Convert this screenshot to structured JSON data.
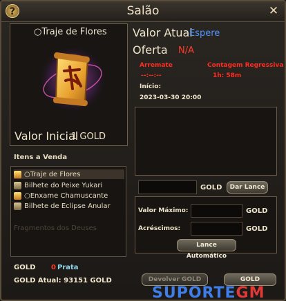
{
  "window": {
    "title": "Salão",
    "help": "?",
    "close": "✕"
  },
  "item": {
    "name": "○Traje de Flores",
    "valor_inicial_label": "Valor Inicial",
    "valor_inicial_value": "1 GOLD"
  },
  "items_for_sale": {
    "heading": "Itens a Venda",
    "rows": [
      {
        "label": "○Traje de Flores",
        "icon": "scroll-icon"
      },
      {
        "label": "Bilhete do Peixe Yukari",
        "icon": "ticket-icon"
      },
      {
        "label": "○Enxame Chamuscante",
        "icon": "scroll-icon"
      },
      {
        "label": "Bilhete de Eclipse Anular",
        "icon": "ticket-icon"
      }
    ],
    "faded_text": "Fragmentos dos Deuses"
  },
  "wallet": {
    "gold_label": "GOLD",
    "prata_value": "0",
    "prata_label": "Prata",
    "gold_atual": "GOLD Atual:  93151 GOLD"
  },
  "auction": {
    "valor_atual_label": "Valor Atual",
    "valor_atual_value": "Espere",
    "oferta_label": "Oferta",
    "oferta_value": "N/A",
    "arremate_label": "Arremate",
    "arremate_value": "--:--:--",
    "contagem_label": "Contagem Regressiva",
    "contagem_value": "1h: 58m",
    "inicio_label": "Início:",
    "inicio_value": "2023-03-30 20:00"
  },
  "bid": {
    "gold_unit": "GOLD",
    "dar_lance": "Dar Lance",
    "valor_maximo_label": "Valor Máximo:",
    "acrescimos_label": "Acréscimos:",
    "lance_automatico": "Lance Automático"
  },
  "footer": {
    "devolver_gold": "Devolver GOLD",
    "gold_button": "GOLD",
    "watermark_blue": "SUPORTE",
    "watermark_red": "GM"
  },
  "colors": {
    "accent_blue": "#4b94ff",
    "alert_red": "#ff2d22",
    "prata_blue": "#8fd7ee"
  }
}
